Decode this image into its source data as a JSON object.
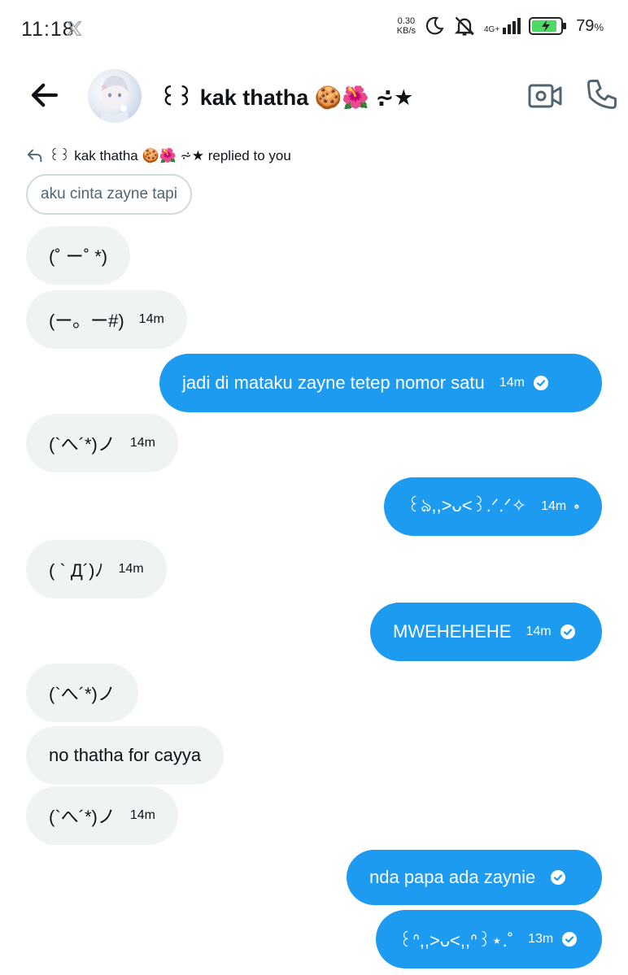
{
  "status_bar": {
    "time": "11:18",
    "speed_value": "0.30",
    "speed_unit": "KB/s",
    "network": "4G+",
    "battery": "79",
    "battery_unit": "%"
  },
  "header": {
    "contact_name": "꒰꒱ kak thatha 🍪🌺 ⩫★",
    "back_icon": "arrow-left-icon",
    "video_icon": "video-camera-icon",
    "call_icon": "phone-icon"
  },
  "reply": {
    "context_text": "꒰꒱ kak thatha 🍪🌺 ⩫★ replied to you",
    "quoted_text": "aku cinta zayne tapi"
  },
  "messages": [
    {
      "text": "(˚ ー˚ *)",
      "time": "",
      "dir": "in"
    },
    {
      "text": "(ー。ー#)",
      "time": "14m",
      "dir": "in"
    },
    {
      "text": "jadi di mataku zayne tetep nomor satu",
      "time": "14m",
      "dir": "out"
    },
    {
      "text": "(`へ´*)ノ",
      "time": "14m",
      "dir": "in"
    },
    {
      "text": "꒰ঌ,,>ᴗ<꒱.ᐟ.ᐟ✧",
      "time": "14m",
      "dir": "out"
    },
    {
      "text": "( ` Д´)ﾉ",
      "time": "14m",
      "dir": "in"
    },
    {
      "text": "MWEHEHEHE",
      "time": "14m",
      "dir": "out"
    },
    {
      "text": "(`へ´*)ノ",
      "time": "",
      "dir": "in"
    },
    {
      "text": "no thatha for cayya",
      "time": "",
      "dir": "in"
    },
    {
      "text": "(`へ´*)ノ",
      "time": "14m",
      "dir": "in"
    },
    {
      "text": "nda papa ada zaynie",
      "time": "",
      "dir": "out"
    },
    {
      "text": "꒰ᐢ,,>ᴗ<,,ᐢ꒱⋆.˚",
      "time": "13m",
      "dir": "out"
    }
  ],
  "colors": {
    "outgoing_bubble": "#1d9bf0",
    "incoming_bubble": "#eff3f4"
  }
}
